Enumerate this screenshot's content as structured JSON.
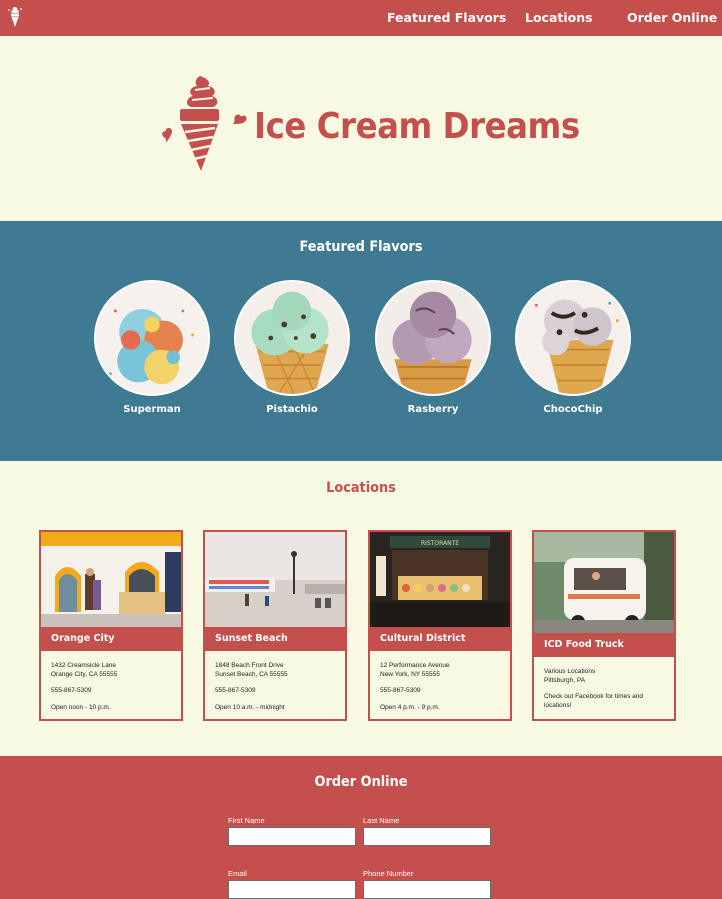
{
  "nav": {
    "logo_icon": "ice-cream-cone-icon",
    "links": [
      "Featured Flavors",
      "Locations",
      "Order Online"
    ]
  },
  "hero": {
    "title": "Ice Cream Dreams",
    "logo_icon": "soft-serve-cone-with-hearts-icon"
  },
  "flavors": {
    "title": "Featured Flavors",
    "items": [
      {
        "name": "Superman"
      },
      {
        "name": "Pistachio"
      },
      {
        "name": "Rasberry"
      },
      {
        "name": "ChocoChip"
      }
    ]
  },
  "locations": {
    "title": "Locations",
    "cards": [
      {
        "name": "Orange City",
        "lines": [
          "1432 Creamsicle Lane",
          "Orange City, CA 55555"
        ],
        "phone": "555-867-5309",
        "hours": "Open noon - 10 p.m."
      },
      {
        "name": "Sunset Beach",
        "lines": [
          "1848 Beach Front Drive",
          "Sunset Beach, CA 55555"
        ],
        "phone": "555-867-5309",
        "hours": "Open 10 a.m. - midnight"
      },
      {
        "name": "Cultural District",
        "lines": [
          "12 Performance Avenue",
          "New York, NY 55555"
        ],
        "phone": "555-867-5309",
        "hours": "Open 4 p.m. - 9 p.m."
      },
      {
        "name": "ICD Food Truck",
        "lines": [
          "Various Locations",
          "Pittsburgh, PA"
        ],
        "note": "Check out Facebook for times and locations!"
      }
    ]
  },
  "order": {
    "title": "Order Online",
    "fields": {
      "first_name": {
        "label": "First Name",
        "value": ""
      },
      "last_name": {
        "label": "Last Name",
        "value": ""
      },
      "email": {
        "label": "Email",
        "value": ""
      },
      "phone": {
        "label": "Phone Number",
        "value": ""
      }
    }
  },
  "colors": {
    "brand_red": "#c4504e",
    "teal": "#3e7b92",
    "cream": "#f8f9e3"
  }
}
